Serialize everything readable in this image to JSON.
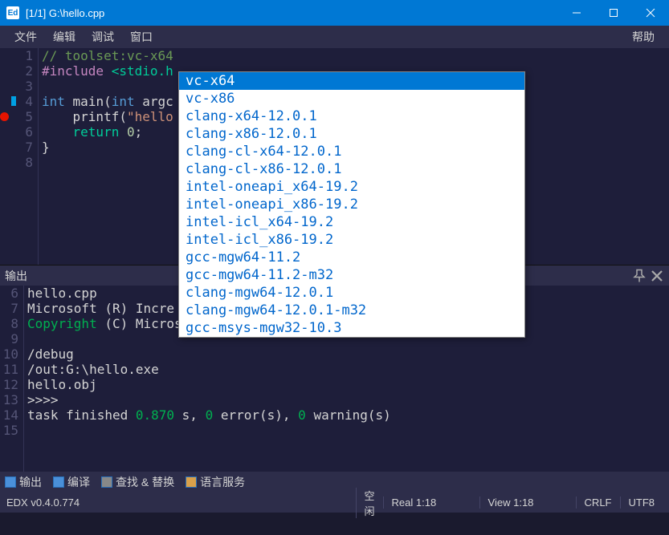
{
  "window": {
    "title": "[1/1] G:\\hello.cpp"
  },
  "menubar": {
    "file": "文件",
    "edit": "编辑",
    "debug": "调试",
    "window": "窗口",
    "help": "帮助"
  },
  "code": {
    "lines": [
      {
        "n": "1",
        "html": "<span class='c-comment'>// toolset:vc-x64</span>"
      },
      {
        "n": "2",
        "html": "<span class='c-preproc'>#include</span> <span class='c-keyword2'>&lt;stdio.h</span>"
      },
      {
        "n": "3",
        "html": ""
      },
      {
        "n": "4",
        "html": "<span class='c-keyword'>int</span> <span class='c-text'>main(</span><span class='c-keyword'>int</span> <span class='c-text'>argc</span>",
        "bookmark": true
      },
      {
        "n": "5",
        "html": "    <span class='c-text'>printf(</span><span class='c-string'>\"hello</span>",
        "bp": true
      },
      {
        "n": "6",
        "html": "    <span class='c-keyword2'>return</span> <span class='c-number'>0</span><span class='c-text'>;</span>"
      },
      {
        "n": "7",
        "html": "<span class='c-text'>}</span>"
      },
      {
        "n": "8",
        "html": ""
      }
    ]
  },
  "dropdown": {
    "items": [
      "vc-x64",
      "vc-x86",
      "clang-x64-12.0.1",
      "clang-x86-12.0.1",
      "clang-cl-x64-12.0.1",
      "clang-cl-x86-12.0.1",
      "intel-oneapi_x64-19.2",
      "intel-oneapi_x86-19.2",
      "intel-icl_x64-19.2",
      "intel-icl_x86-19.2",
      "gcc-mgw64-11.2",
      "gcc-mgw64-11.2-m32",
      "clang-mgw64-12.0.1",
      "clang-mgw64-12.0.1-m32",
      "gcc-msys-mgw32-10.3"
    ],
    "selected": 0
  },
  "output": {
    "title": "输出",
    "lines": [
      {
        "n": "6",
        "html": "hello.cpp"
      },
      {
        "n": "7",
        "html": "Microsoft (R) Incre"
      },
      {
        "n": "8",
        "html": "<span class='out-green'>Copyright</span> (C) Micros"
      },
      {
        "n": "9",
        "html": ""
      },
      {
        "n": "10",
        "html": "/debug"
      },
      {
        "n": "11",
        "html": "/out:G:\\hello.exe"
      },
      {
        "n": "12",
        "html": "hello.obj"
      },
      {
        "n": "13",
        "html": ">>>>"
      },
      {
        "n": "14",
        "html": "task finished <span class='out-green'>0.870</span> s, <span class='out-green'>0</span> error(s), <span class='out-green'>0</span> warning(s)"
      },
      {
        "n": "15",
        "html": ""
      }
    ]
  },
  "bottomTabs": {
    "output": "输出",
    "compile": "编译",
    "find": "查找 & 替换",
    "lang": "语言服务"
  },
  "status": {
    "version": "EDX v0.4.0.774",
    "idle": "空闲",
    "real": "Real 1:18",
    "view": "View 1:18",
    "crlf": "CRLF",
    "enc": "UTF8"
  }
}
